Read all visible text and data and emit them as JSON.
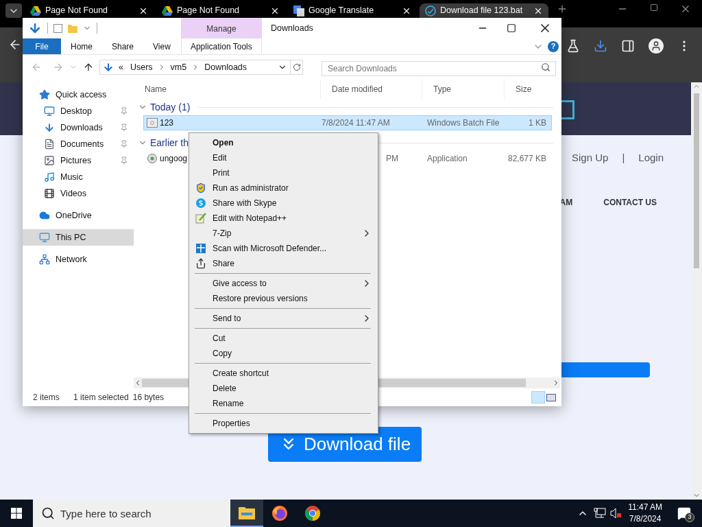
{
  "browser": {
    "tabs": [
      {
        "title": "Page Not Found",
        "kind": "drive",
        "selected": false
      },
      {
        "title": "Page Not Found",
        "kind": "drive",
        "selected": false
      },
      {
        "title": "Google Translate",
        "kind": "translate",
        "selected": false
      },
      {
        "title": "Download file 123.bat",
        "kind": "site",
        "selected": true
      }
    ],
    "page": {
      "nav_links": [
        "Sign Up",
        "|",
        "Login"
      ],
      "menu_items": [
        "AM",
        "CONTACT US"
      ],
      "download_button": "Download file"
    }
  },
  "explorer": {
    "title": "Downloads",
    "contextual_tab": "Manage",
    "ribbon_tabs": [
      {
        "label": "File",
        "kind": "file"
      },
      {
        "label": "Home",
        "kind": "tab"
      },
      {
        "label": "Share",
        "kind": "tab"
      },
      {
        "label": "View",
        "kind": "tab"
      },
      {
        "label": "Application Tools",
        "kind": "contextual"
      }
    ],
    "breadcrumb": [
      "«",
      "Users",
      "vm5",
      "Downloads"
    ],
    "help": "?",
    "search": {
      "placeholder": "Search Downloads"
    },
    "nav": [
      {
        "label": "Quick access",
        "kind": "star",
        "selected": false,
        "children": [
          {
            "label": "Desktop",
            "kind": "desktop",
            "pinned": true,
            "selected": false
          },
          {
            "label": "Downloads",
            "kind": "download",
            "pinned": true,
            "selected": false
          },
          {
            "label": "Documents",
            "kind": "document",
            "pinned": true,
            "selected": false
          },
          {
            "label": "Pictures",
            "kind": "pictures",
            "pinned": true,
            "selected": false
          },
          {
            "label": "Music",
            "kind": "music",
            "pinned": false,
            "selected": false
          },
          {
            "label": "Videos",
            "kind": "videos",
            "pinned": false,
            "selected": false
          }
        ]
      },
      {
        "label": "OneDrive",
        "kind": "cloud",
        "selected": false
      },
      {
        "label": "This PC",
        "kind": "pc",
        "selected": true
      },
      {
        "label": "Network",
        "kind": "network",
        "selected": false
      }
    ],
    "columns": [
      "Name",
      "Date modified",
      "Type",
      "Size"
    ],
    "groups": [
      {
        "label": "Today (1)",
        "files": [
          {
            "name": "123",
            "date": "7/8/2024 11:47 AM",
            "type": "Windows Batch File",
            "size": "1 KB",
            "kind": "batch",
            "selected": true
          }
        ]
      },
      {
        "label": "Earlier th",
        "files": [
          {
            "name": "ungoog",
            "date": "PM",
            "type": "Application",
            "size": "82,677 KB",
            "kind": "app",
            "selected": false
          }
        ]
      }
    ],
    "status": {
      "count": "2 items",
      "selection": "1 item selected",
      "size": "16 bytes"
    }
  },
  "context_menu": [
    {
      "kind": "item",
      "label": "Open",
      "default": true,
      "submenu": false
    },
    {
      "kind": "item",
      "label": "Edit",
      "default": false,
      "submenu": false
    },
    {
      "kind": "item",
      "label": "Print",
      "default": false,
      "submenu": false
    },
    {
      "kind": "item",
      "label": "Run as administrator",
      "default": false,
      "submenu": false
    },
    {
      "kind": "item",
      "label": "Share with Skype",
      "default": false,
      "submenu": false
    },
    {
      "kind": "item",
      "label": "Edit with Notepad++",
      "default": false,
      "submenu": false
    },
    {
      "kind": "item",
      "label": "7-Zip",
      "default": false,
      "submenu": true
    },
    {
      "kind": "item",
      "label": "Scan with Microsoft Defender...",
      "default": false,
      "submenu": false
    },
    {
      "kind": "item",
      "label": "Share",
      "default": false,
      "submenu": false
    },
    {
      "kind": "separator"
    },
    {
      "kind": "item",
      "label": "Give access to",
      "default": false,
      "submenu": true
    },
    {
      "kind": "item",
      "label": "Restore previous versions",
      "default": false,
      "submenu": false
    },
    {
      "kind": "separator"
    },
    {
      "kind": "item",
      "label": "Send to",
      "default": false,
      "submenu": true
    },
    {
      "kind": "separator"
    },
    {
      "kind": "item",
      "label": "Cut",
      "default": false,
      "submenu": false
    },
    {
      "kind": "item",
      "label": "Copy",
      "default": false,
      "submenu": false
    },
    {
      "kind": "separator"
    },
    {
      "kind": "item",
      "label": "Create shortcut",
      "default": false,
      "submenu": false
    },
    {
      "kind": "item",
      "label": "Delete",
      "default": false,
      "submenu": false
    },
    {
      "kind": "item",
      "label": "Rename",
      "default": false,
      "submenu": false
    },
    {
      "kind": "separator"
    },
    {
      "kind": "item",
      "label": "Properties",
      "default": false,
      "submenu": false
    }
  ],
  "taskbar": {
    "search_placeholder": "Type here to search",
    "apps": [
      {
        "kind": "explorer",
        "selected": true
      },
      {
        "kind": "firefox",
        "selected": false
      },
      {
        "kind": "chrome",
        "selected": false
      }
    ],
    "time": "11:47 AM",
    "date": "7/8/2024",
    "notifications": "3"
  }
}
